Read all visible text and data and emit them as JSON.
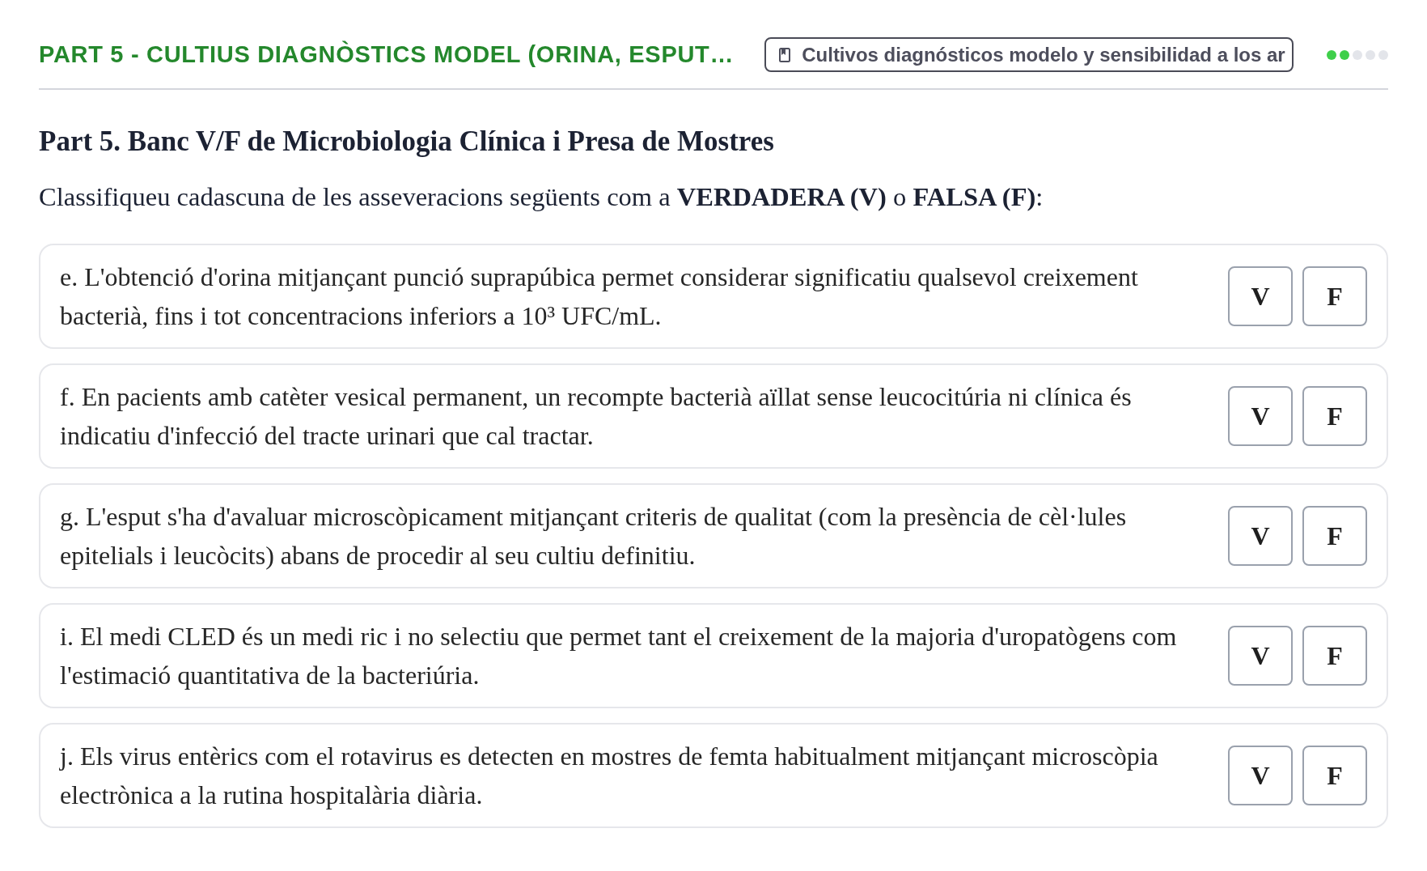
{
  "header": {
    "title": "PART 5 - CULTIUS DIAGNÒSTICS MODEL (ORINA, ESPUT…",
    "source_chip": {
      "label": "Cultivos diagnósticos modelo y sensibilidad a los ar"
    },
    "progress": [
      {
        "filled": true
      },
      {
        "filled": true
      },
      {
        "filled": false
      },
      {
        "filled": false
      },
      {
        "filled": false
      }
    ]
  },
  "section": {
    "heading": "Part 5. Banc V/F de Microbiologia Clínica i Presa de Mostres",
    "instruction": "Classifiqueu cadascuna de les asseveracions següents com a **VERDADERA (V)** o **FALSA (F)**:"
  },
  "statements": [
    {
      "text": "e. L'obtenció d'orina mitjançant punció suprapúbica permet considerar significatiu qualsevol creixement bacterià, fins i tot concentracions inferiors a 10³ UFC/mL.",
      "options": [
        {
          "label": "V",
          "selected": false
        },
        {
          "label": "F",
          "selected": false
        }
      ]
    },
    {
      "text": "f. En pacients amb catèter vesical permanent, un recompte bacterià aïllat sense leucocitúria ni clínica és indicatiu d'infecció del tracte urinari que cal tractar.",
      "options": [
        {
          "label": "V",
          "selected": false
        },
        {
          "label": "F",
          "selected": false
        }
      ]
    },
    {
      "text": "g. L'esput s'ha d'avaluar microscòpicament mitjançant criteris de qualitat (com la presència de cèl·lules epitelials i leucòcits) abans de procedir al seu cultiu definitiu.",
      "options": [
        {
          "label": "V",
          "selected": false
        },
        {
          "label": "F",
          "selected": false
        }
      ]
    },
    {
      "text": "i. El medi CLED és un medi ric i no selectiu que permet tant el creixement de la majoria d'uropatògens com l'estimació quantitativa de la bacteriúria.",
      "options": [
        {
          "label": "V",
          "selected": false
        },
        {
          "label": "F",
          "selected": false
        }
      ]
    },
    {
      "text": "j. Els virus entèrics com el rotavirus es detecten en mostres de femta habitualment mitjançant microscòpia electrònica a la rutina hospitalària diària.",
      "options": [
        {
          "label": "V",
          "selected": false
        },
        {
          "label": "F",
          "selected": false
        }
      ]
    }
  ]
}
